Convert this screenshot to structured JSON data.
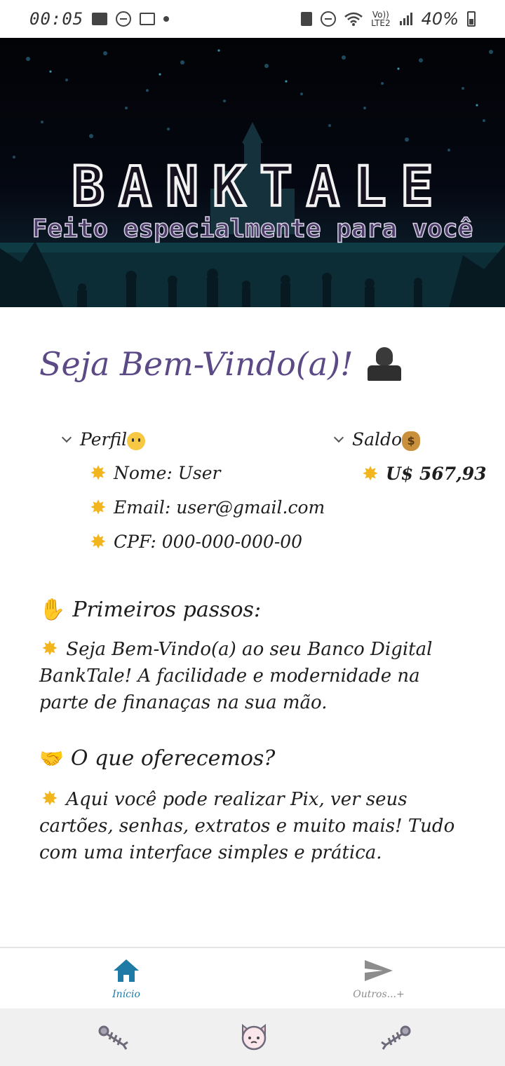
{
  "status_bar": {
    "time": "00:05",
    "battery": "40%",
    "network": "Vo))\nLTE2"
  },
  "banner": {
    "title": "BANKTALE",
    "subtitle": "Feito especialmente para você"
  },
  "welcome": {
    "title": "Seja Bem-Vindo(a)!",
    "icon": "person-silhouette-icon"
  },
  "profile": {
    "label": "Perfil",
    "items": [
      "Nome: User",
      "Email: user@gmail.com",
      "CPF: 000-000-000-00"
    ]
  },
  "balance": {
    "label": "Saldo",
    "value": "U$ 567,93"
  },
  "first_steps": {
    "title": "Primeiros passos:",
    "text": "Seja Bem-Vindo(a) ao seu Banco Digital BankTale! A facilidade e modernidade na parte de finanaças na sua mão."
  },
  "offer": {
    "title": "O que oferecemos?",
    "text": "Aqui você pode realizar Pix, ver seus cartões, senhas, extratos e muito mais! Tudo com uma interface simples e prática."
  },
  "tabs": [
    {
      "label": "Início",
      "icon": "home-icon",
      "active": true
    },
    {
      "label": "Outros...+",
      "icon": "send-icon",
      "active": false
    }
  ],
  "colors": {
    "accent": "#1f7aa6",
    "title_purple": "#5b4a86",
    "star": "#f2b51e"
  }
}
